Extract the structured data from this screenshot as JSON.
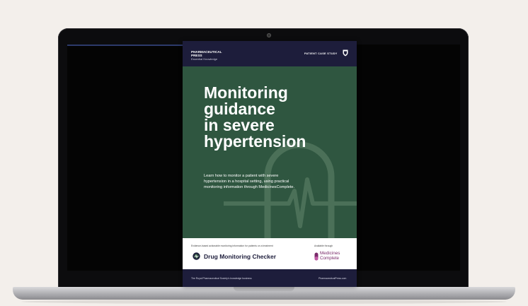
{
  "document": {
    "publisher_name": "PHARMACEUTICAL PRESS",
    "publisher_tagline": "Essential Knowledge",
    "case_label": "PATIENT CASE STUDY",
    "title_lines": [
      "Monitoring",
      "guidance",
      "in severe",
      "hypertension"
    ],
    "description": "Learn how to monitor a patient with severe hypertension in a hospital setting, using practical monitoring information through MedicinesComplete.",
    "footer_caption": "Evidence-based actionable monitoring information for patients on a treatment",
    "product_name": "Drug Monitoring Checker",
    "available_label": "Available through",
    "partner_logo_lines": [
      "Medicines",
      "Complete"
    ],
    "bottom_left": "The Royal Pharmaceutical Society's knowledge business",
    "bottom_right": "PharmaceuticalPress.com"
  },
  "colors": {
    "cover_green": "#2f5640",
    "header_navy": "#1d1d3b",
    "partner_purple": "#7a2a6a",
    "background": "#f3efeb"
  },
  "icons": [
    "crest-icon",
    "heart-monitor-graphic",
    "drug-monitoring-icon",
    "medicines-complete-icon"
  ]
}
